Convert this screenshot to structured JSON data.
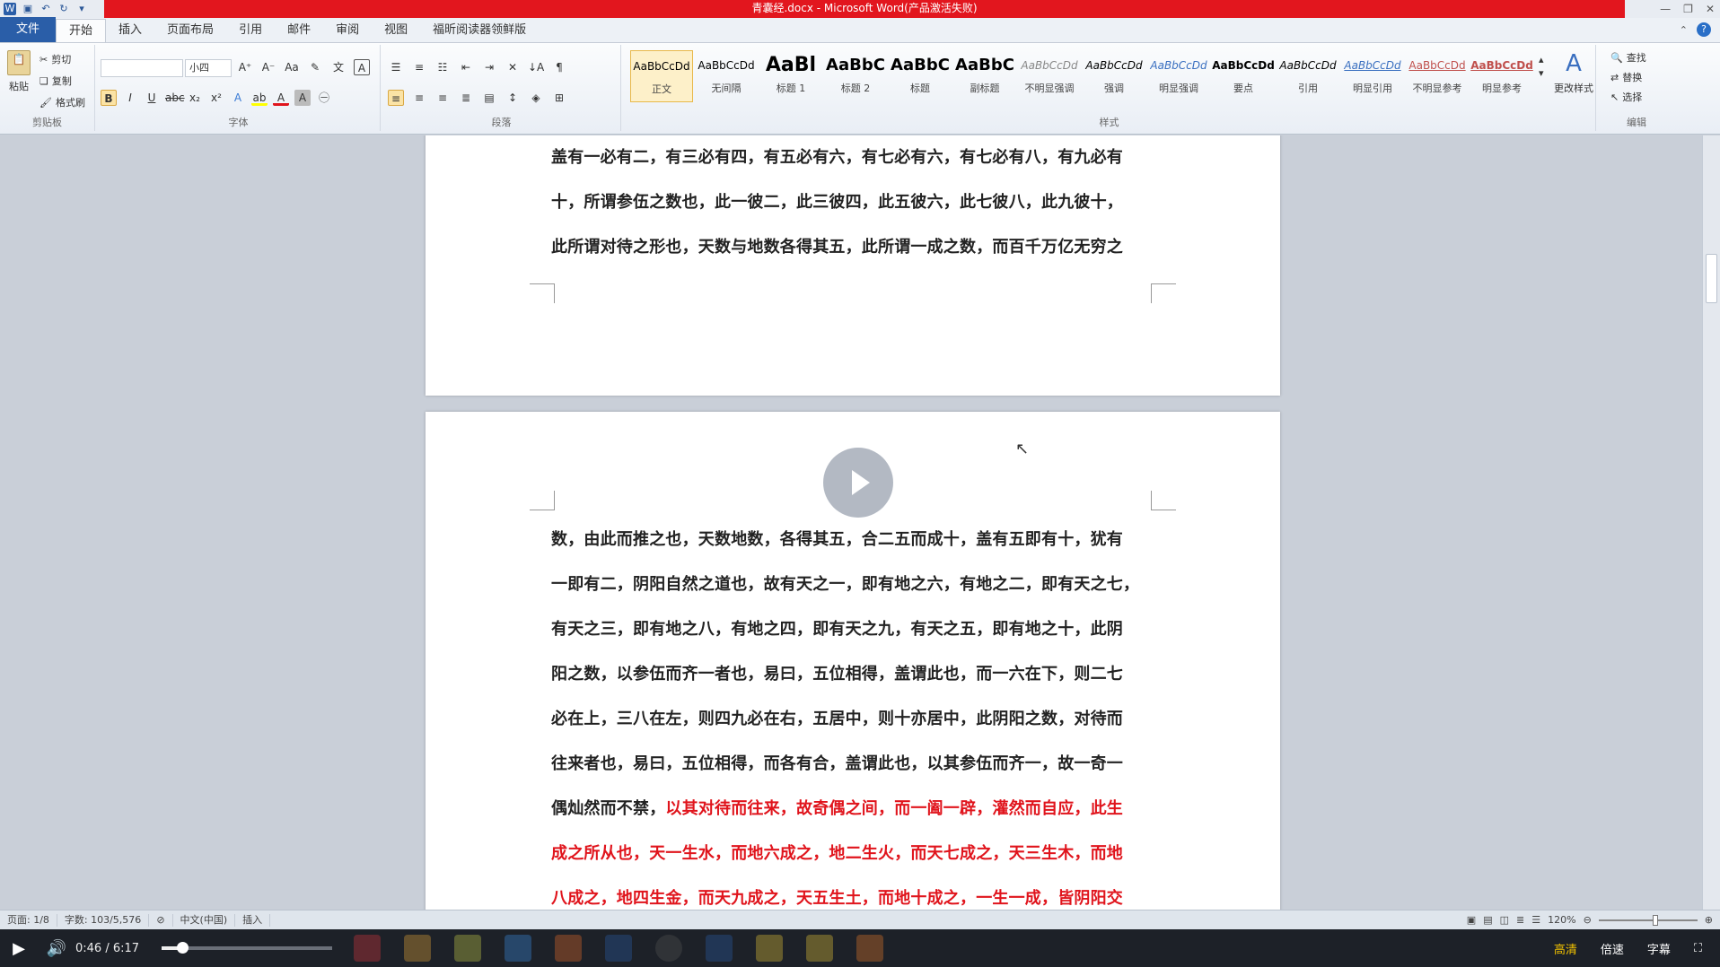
{
  "window": {
    "title": "青囊经.docx - Microsoft Word(产品激活失败)"
  },
  "tabs": [
    {
      "label": "文件"
    },
    {
      "label": "开始"
    },
    {
      "label": "插入"
    },
    {
      "label": "页面布局"
    },
    {
      "label": "引用"
    },
    {
      "label": "邮件"
    },
    {
      "label": "审阅"
    },
    {
      "label": "视图"
    },
    {
      "label": "福昕阅读器领鲜版"
    }
  ],
  "ribbon": {
    "clipboard": {
      "paste": "粘贴",
      "cut": "剪切",
      "copy": "复制",
      "format_painter": "格式刷",
      "label": "剪贴板"
    },
    "font": {
      "font_name": "",
      "font_size": "小四",
      "label": "字体"
    },
    "paragraph": {
      "label": "段落"
    },
    "styles": {
      "label": "样式",
      "items": [
        {
          "preview": "AaBbCcDd",
          "name": "正文"
        },
        {
          "preview": "AaBbCcDd",
          "name": "无间隔"
        },
        {
          "preview": "AaBl",
          "name": "标题 1"
        },
        {
          "preview": "AaBbC",
          "name": "标题 2"
        },
        {
          "preview": "AaBbC",
          "name": "标题"
        },
        {
          "preview": "AaBbC",
          "name": "副标题"
        },
        {
          "preview": "AaBbCcDd",
          "name": "不明显强调"
        },
        {
          "preview": "AaBbCcDd",
          "name": "强调"
        },
        {
          "preview": "AaBbCcDd",
          "name": "明显强调"
        },
        {
          "preview": "AaBbCcDd",
          "name": "要点"
        },
        {
          "preview": "AaBbCcDd",
          "name": "引用"
        },
        {
          "preview": "AaBbCcDd",
          "name": "明显引用"
        },
        {
          "preview": "AaBbCcDd",
          "name": "不明显参考"
        },
        {
          "preview": "AaBbCcDd",
          "name": "明显参考"
        }
      ],
      "change_styles": "更改样式"
    },
    "editing": {
      "find": "查找",
      "replace": "替换",
      "select": "选择",
      "label": "编辑"
    }
  },
  "document": {
    "page1_lines": [
      "盖有一必有二，有三必有四，有五必有六，有七必有六，有七必有八，有九必有",
      "十，所谓参伍之数也，此一彼二，此三彼四，此五彼六，此七彼八，此九彼十，",
      "此所谓对待之形也，天数与地数各得其五，此所谓一成之数，而百千万亿无穷之"
    ],
    "page2_lines": [
      "数，由此而推之也，天数地数，各得其五，合二五而成十，盖有五即有十，犹有",
      "一即有二，阴阳自然之道也，故有天之一，即有地之六，有地之二，即有天之七，",
      "有天之三，即有地之八，有地之四，即有天之九，有天之五，即有地之十，此阴",
      "阳之数，以参伍而齐一者也，易曰，五位相得，盖谓此也，而一六在下，则二七",
      "必在上，三八在左，则四九必在右，五居中，则十亦居中，此阴阳之数，对待而",
      "往来者也，易曰，五位相得，而各有合，盖谓此也，以其参伍而齐一，故一奇一"
    ],
    "page2_mixed_line": {
      "black": "偶灿然而不禁，",
      "red": "以其对待而往来，故奇偶之间，而一阖一辟，灌然而自应，此生"
    },
    "page2_red_lines": [
      "成之所从也，天一生水，而地六成之，地二生火，而天七成之，天三生木，而地",
      "八成之，地四生金，而天九成之，天五生土，而地十成之，一生一成，皆阴阳交"
    ],
    "red_color": "#e0141c"
  },
  "statusbar": {
    "page": "页面: 1/8",
    "words": "字数: 103/5,576",
    "language": "中文(中国)",
    "mode": "插入",
    "zoom": "120%"
  },
  "player": {
    "time": "0:46 / 6:17",
    "progress": 0.122,
    "quality": "高清",
    "speed": "倍速",
    "subtitle": "字幕"
  }
}
